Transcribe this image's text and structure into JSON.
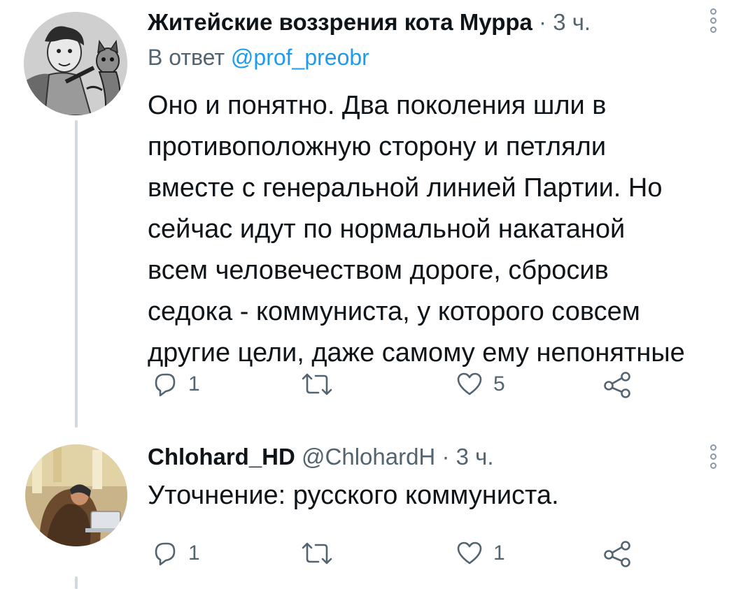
{
  "tweets": [
    {
      "name": "Житейские воззрения кота Мурра",
      "sep": "·",
      "time": "3 ч.",
      "replying_prefix": "В ответ",
      "replying_handle": "@prof_preobr",
      "lines": [
        "Оно и понятно. Два поколения шли в",
        "противоположную сторону  и петляли",
        "вместе с генеральной линией Партии. Но",
        "сейчас идут по нормальной накатаной",
        "всем человечеством дороге, сбросив",
        "седока - коммуниста, у которого совсем",
        "другие цели, даже самому ему непонятные"
      ],
      "reply_count": "1",
      "like_count": "5"
    },
    {
      "name": "Chlohard_HD",
      "handle": "@ChlohardH",
      "sep": "·",
      "time": "3 ч.",
      "lines": [
        "Уточнение: русского коммуниста."
      ],
      "reply_count": "1",
      "like_count": "1"
    }
  ],
  "icons": {
    "more": "more-vertical-icon",
    "reply": "reply-icon",
    "retweet": "retweet-icon",
    "like": "heart-icon",
    "share": "share-icon"
  },
  "colors": {
    "text": "#0f1419",
    "muted": "#536471",
    "link": "#1d9bf0",
    "thread_line": "#cfd9de"
  }
}
